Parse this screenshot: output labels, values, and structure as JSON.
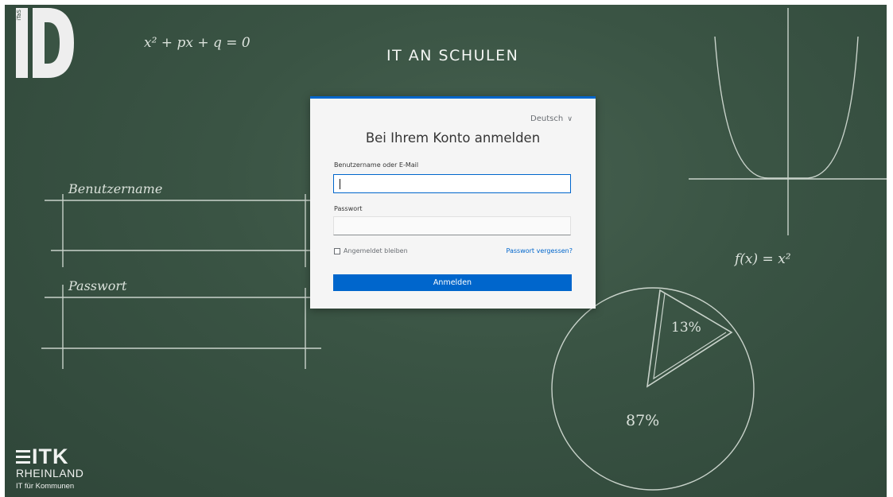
{
  "branding": {
    "logo_letters": "ID",
    "logo_prefix": "iTaS",
    "site_title": "IT AN SCHULEN",
    "itk_name": "ITK",
    "itk_region": "RHEINLAND",
    "itk_tagline": "IT für Kommunen"
  },
  "chalkboard": {
    "equation_quadratic": "x² + px + q = 0",
    "equation_function": "f(x) = x²",
    "label_username": "Benutzername",
    "label_password": "Passwort",
    "pie_small_percent": "13%",
    "pie_large_percent": "87%"
  },
  "login": {
    "language": "Deutsch",
    "title": "Bei Ihrem Konto anmelden",
    "username_label": "Benutzername oder E-Mail",
    "username_value": "",
    "password_label": "Passwort",
    "password_value": "",
    "remember_label": "Angemeldet bleiben",
    "remember_checked": false,
    "forgot_link": "Passwort vergessen?",
    "submit_label": "Anmelden"
  },
  "colors": {
    "accent": "#0066cc",
    "board": "#3a5444",
    "chalk": "#e9efe9"
  }
}
